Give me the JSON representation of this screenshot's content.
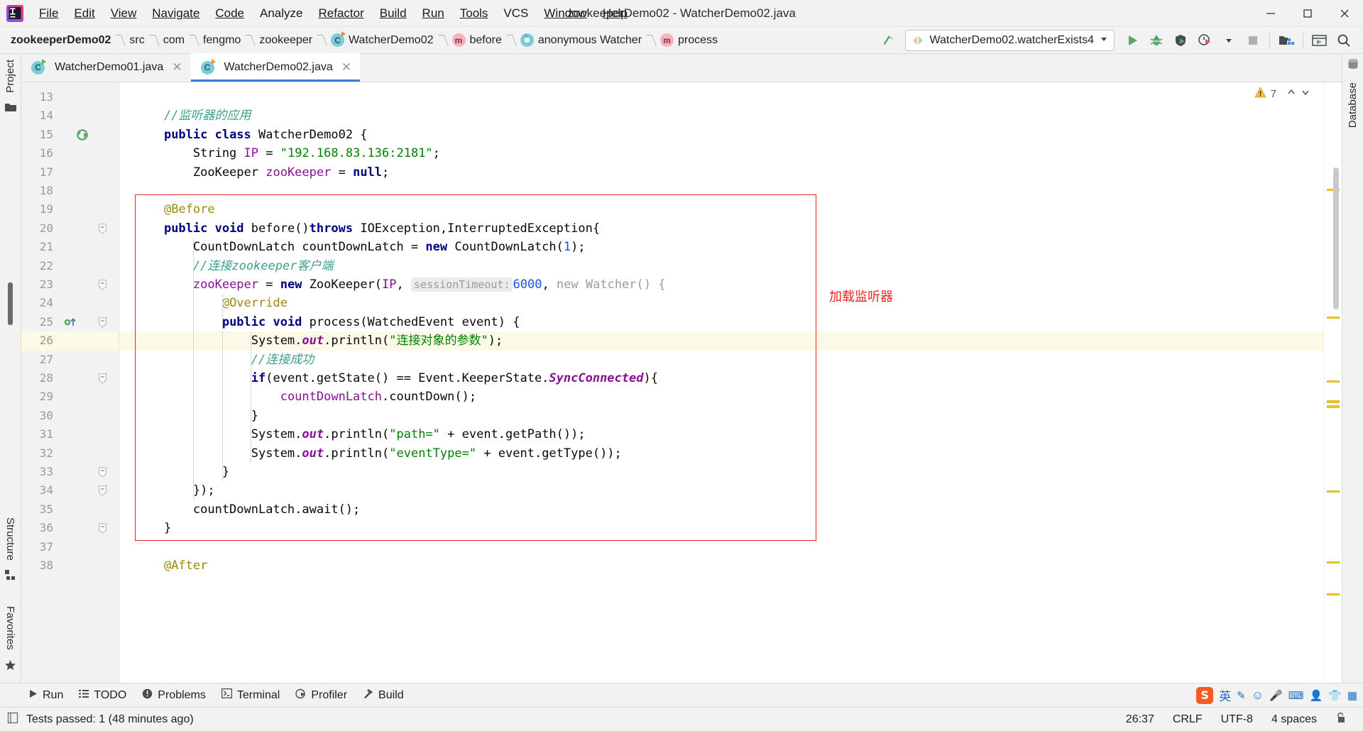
{
  "window": {
    "title": "zookeeperDemo02 - WatcherDemo02.java",
    "app_icon": "intellij-idea-logo",
    "minimize": "–",
    "maximize": "▢",
    "close": "✕"
  },
  "menubar": [
    {
      "label": "File"
    },
    {
      "label": "Edit"
    },
    {
      "label": "View"
    },
    {
      "label": "Navigate"
    },
    {
      "label": "Code"
    },
    {
      "label": "Analyze"
    },
    {
      "label": "Refactor"
    },
    {
      "label": "Build"
    },
    {
      "label": "Run"
    },
    {
      "label": "Tools"
    },
    {
      "label": "VCS"
    },
    {
      "label": "Window"
    },
    {
      "label": "Help"
    }
  ],
  "breadcrumb": [
    {
      "label": "zookeeperDemo02",
      "icon": "",
      "bold": true
    },
    {
      "label": "src",
      "icon": ""
    },
    {
      "label": "com",
      "icon": ""
    },
    {
      "label": "fengmo",
      "icon": ""
    },
    {
      "label": "zookeeper",
      "icon": ""
    },
    {
      "label": "WatcherDemo02",
      "icon": "class-icon"
    },
    {
      "label": "before",
      "icon": "method-icon"
    },
    {
      "label": "anonymous Watcher",
      "icon": "anonymous-class-icon"
    },
    {
      "label": "process",
      "icon": "method-icon"
    }
  ],
  "toolbar": {
    "run_config": "WatcherDemo02.watcherExists4",
    "run_config_caret": "▼",
    "buttons": [
      {
        "name": "run-button",
        "icon": "play-icon"
      },
      {
        "name": "debug-button",
        "icon": "bug-icon"
      },
      {
        "name": "run-with-coverage-button",
        "icon": "coverage-icon"
      },
      {
        "name": "profile-button",
        "icon": "profiler-icon"
      },
      {
        "name": "more-run-options-button",
        "icon": "chevron-down-icon"
      },
      {
        "name": "stop-button",
        "icon": "stop-icon"
      },
      {
        "name": "project-structure-button",
        "icon": "project-structure-icon"
      },
      {
        "name": "updates-button",
        "icon": "window-icon"
      },
      {
        "name": "search-everywhere-button",
        "icon": "search-icon"
      }
    ]
  },
  "tabs": [
    {
      "label": "WatcherDemo01.java",
      "icon": "java-class-icon",
      "active": false,
      "close": "✕"
    },
    {
      "label": "WatcherDemo02.java",
      "icon": "java-class-icon",
      "active": true,
      "close": "✕"
    }
  ],
  "left_rail": {
    "top": "Project",
    "structure": "Structure",
    "favorites": "Favorites"
  },
  "right_rail": {
    "database": "Database"
  },
  "inspections": {
    "warning_count": "7",
    "warning_icon": "warning-triangle-icon",
    "up": "⌃",
    "down": "⌄"
  },
  "annotation": {
    "text": "加载监听器",
    "color": "#e8241c"
  },
  "editor": {
    "first_line": 13,
    "lines": [
      {
        "n": 13,
        "tokens": []
      },
      {
        "n": 14,
        "tokens": [
          {
            "t": "    //监听器的应用",
            "c": "hl-comment"
          }
        ]
      },
      {
        "n": 15,
        "tokens": [
          {
            "t": "    ",
            "c": ""
          },
          {
            "t": "public class",
            "c": "hl-kw"
          },
          {
            "t": " WatcherDemo02 {",
            "c": ""
          }
        ],
        "gutter": "run-class-icon"
      },
      {
        "n": 16,
        "tokens": [
          {
            "t": "        String ",
            "c": ""
          },
          {
            "t": "IP",
            "c": "hl-field"
          },
          {
            "t": " = ",
            "c": ""
          },
          {
            "t": "\"192.168.83.136:2181\"",
            "c": "hl-string"
          },
          {
            "t": ";",
            "c": ""
          }
        ]
      },
      {
        "n": 17,
        "tokens": [
          {
            "t": "        ZooKeeper ",
            "c": ""
          },
          {
            "t": "zooKeeper",
            "c": "hl-field"
          },
          {
            "t": " = ",
            "c": ""
          },
          {
            "t": "null",
            "c": "hl-kw"
          },
          {
            "t": ";",
            "c": ""
          }
        ]
      },
      {
        "n": 18,
        "tokens": []
      },
      {
        "n": 19,
        "tokens": [
          {
            "t": "    ",
            "c": ""
          },
          {
            "t": "@Before",
            "c": "hl-anno"
          }
        ]
      },
      {
        "n": 20,
        "tokens": [
          {
            "t": "    ",
            "c": ""
          },
          {
            "t": "public void",
            "c": "hl-kw"
          },
          {
            "t": " before()",
            "c": ""
          },
          {
            "t": "throws",
            "c": "hl-kw"
          },
          {
            "t": " IOException,InterruptedException{",
            "c": ""
          }
        ],
        "fold": true
      },
      {
        "n": 21,
        "tokens": [
          {
            "t": "        CountDownLatch countDownLatch = ",
            "c": ""
          },
          {
            "t": "new",
            "c": "hl-kw"
          },
          {
            "t": " CountDownLatch(",
            "c": ""
          },
          {
            "t": "1",
            "c": "hl-num"
          },
          {
            "t": ");",
            "c": ""
          }
        ]
      },
      {
        "n": 22,
        "tokens": [
          {
            "t": "        //连接zookeeper客户端",
            "c": "hl-comment"
          }
        ]
      },
      {
        "n": 23,
        "tokens": [
          {
            "t": "        ",
            "c": ""
          },
          {
            "t": "zooKeeper",
            "c": "hl-field"
          },
          {
            "t": " = ",
            "c": ""
          },
          {
            "t": "new",
            "c": "hl-kw"
          },
          {
            "t": " ZooKeeper(",
            "c": ""
          },
          {
            "t": "IP",
            "c": "hl-field"
          },
          {
            "t": ", ",
            "c": ""
          },
          {
            "t": "HINT:sessionTimeout:",
            "c": "hl-hint"
          },
          {
            "t": "6000",
            "c": "hl-num"
          },
          {
            "t": ", ",
            "c": ""
          },
          {
            "t": "new",
            "c": "hl-dim"
          },
          {
            "t": " Watcher() {",
            "c": "hl-dim"
          }
        ],
        "fold": true
      },
      {
        "n": 24,
        "tokens": [
          {
            "t": "            ",
            "c": ""
          },
          {
            "t": "@Override",
            "c": "hl-anno"
          }
        ]
      },
      {
        "n": 25,
        "tokens": [
          {
            "t": "            ",
            "c": ""
          },
          {
            "t": "public void",
            "c": "hl-kw"
          },
          {
            "t": " process(WatchedEvent event) {",
            "c": ""
          }
        ],
        "gutter": "override-method-icon",
        "fold": true
      },
      {
        "n": 26,
        "tokens": [
          {
            "t": "                System.",
            "c": ""
          },
          {
            "t": "out",
            "c": "hl-sfield"
          },
          {
            "t": ".println(",
            "c": ""
          },
          {
            "t": "\"连接对象的参数\"",
            "c": "hl-string"
          },
          {
            "t": ");",
            "c": ""
          }
        ],
        "caret": true
      },
      {
        "n": 27,
        "tokens": [
          {
            "t": "                //连接成功",
            "c": "hl-comment"
          }
        ]
      },
      {
        "n": 28,
        "tokens": [
          {
            "t": "                ",
            "c": ""
          },
          {
            "t": "if",
            "c": "hl-kw"
          },
          {
            "t": "(event.getState() == Event.KeeperState.",
            "c": ""
          },
          {
            "t": "SyncConnected",
            "c": "hl-sfield"
          },
          {
            "t": "){",
            "c": ""
          }
        ],
        "fold": true
      },
      {
        "n": 29,
        "tokens": [
          {
            "t": "                    ",
            "c": ""
          },
          {
            "t": "countDownLatch",
            "c": "hl-field"
          },
          {
            "t": ".countDown();",
            "c": ""
          }
        ]
      },
      {
        "n": 30,
        "tokens": [
          {
            "t": "                }",
            "c": ""
          }
        ]
      },
      {
        "n": 31,
        "tokens": [
          {
            "t": "                System.",
            "c": ""
          },
          {
            "t": "out",
            "c": "hl-sfield"
          },
          {
            "t": ".println(",
            "c": ""
          },
          {
            "t": "\"path=\"",
            "c": "hl-string"
          },
          {
            "t": " + event.getPath());",
            "c": ""
          }
        ]
      },
      {
        "n": 32,
        "tokens": [
          {
            "t": "                System.",
            "c": ""
          },
          {
            "t": "out",
            "c": "hl-sfield"
          },
          {
            "t": ".println(",
            "c": ""
          },
          {
            "t": "\"eventType=\"",
            "c": "hl-string"
          },
          {
            "t": " + event.getType());",
            "c": ""
          }
        ]
      },
      {
        "n": 33,
        "tokens": [
          {
            "t": "            }",
            "c": ""
          }
        ],
        "fold": true
      },
      {
        "n": 34,
        "tokens": [
          {
            "t": "        });",
            "c": ""
          }
        ],
        "fold": true
      },
      {
        "n": 35,
        "tokens": [
          {
            "t": "        countDownLatch.await();",
            "c": ""
          }
        ]
      },
      {
        "n": 36,
        "tokens": [
          {
            "t": "    }",
            "c": ""
          }
        ],
        "fold": true
      },
      {
        "n": 37,
        "tokens": []
      },
      {
        "n": 38,
        "tokens": [
          {
            "t": "    ",
            "c": ""
          },
          {
            "t": "@After",
            "c": "hl-anno"
          }
        ]
      }
    ]
  },
  "bottom_bar": [
    {
      "label": "Run",
      "icon": "play-icon"
    },
    {
      "label": "TODO",
      "icon": "todo-list-icon"
    },
    {
      "label": "Problems",
      "icon": "problems-icon"
    },
    {
      "label": "Terminal",
      "icon": "terminal-icon"
    },
    {
      "label": "Profiler",
      "icon": "profiler-icon"
    },
    {
      "label": "Build",
      "icon": "hammer-icon"
    }
  ],
  "ime_tray": {
    "logo": "S",
    "items": [
      "英",
      "✎",
      "☺",
      "🎤",
      "⌨",
      "👤",
      "👕",
      "▦"
    ]
  },
  "status_bar": {
    "message": "Tests passed: 1 (48 minutes ago)",
    "message_icon": "tests-passed-icon",
    "caret_position": "26:37",
    "line_separator": "CRLF",
    "encoding": "UTF-8",
    "indent": "4 spaces",
    "lock_icon": "unlocked-icon"
  }
}
